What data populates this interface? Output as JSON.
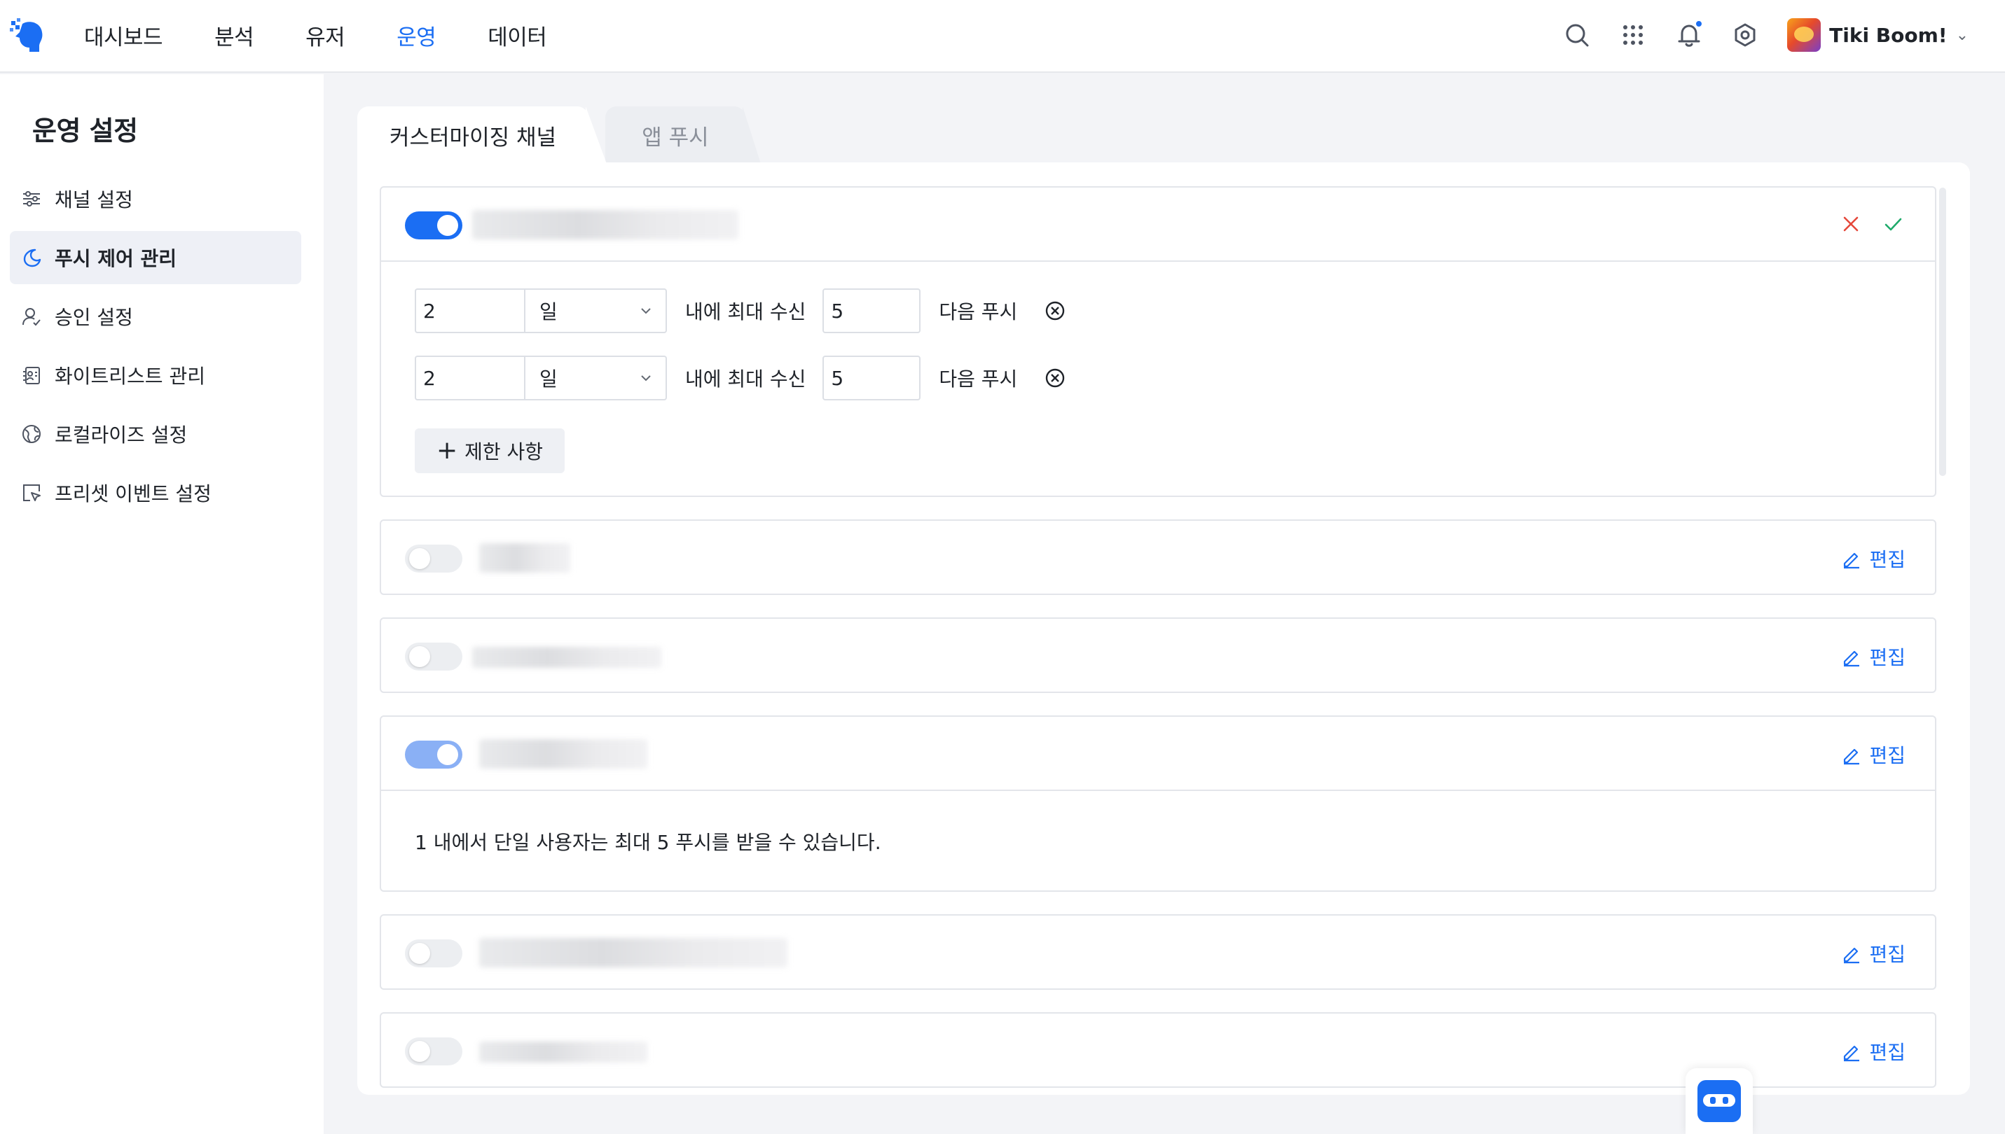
{
  "header": {
    "nav": [
      {
        "label": "대시보드",
        "active": false
      },
      {
        "label": "분석",
        "active": false
      },
      {
        "label": "유저",
        "active": false
      },
      {
        "label": "운영",
        "active": true
      },
      {
        "label": "데이터",
        "active": false
      }
    ],
    "icons": [
      "search-icon",
      "apps-grid-icon",
      "bell-icon",
      "settings-icon"
    ],
    "notification_dot": true,
    "user_name": "Tiki Boom!"
  },
  "sidebar": {
    "title": "운영 설정",
    "items": [
      {
        "label": "채널 설정",
        "icon": "sliders-icon",
        "active": false
      },
      {
        "label": "푸시 제어 관리",
        "icon": "moon-icon",
        "active": true
      },
      {
        "label": "승인 설정",
        "icon": "user-check-icon",
        "active": false
      },
      {
        "label": "화이트리스트 관리",
        "icon": "contact-list-icon",
        "active": false
      },
      {
        "label": "로컬라이즈 설정",
        "icon": "globe-icon",
        "active": false
      },
      {
        "label": "프리셋 이벤트 설정",
        "icon": "cursor-box-icon",
        "active": false
      }
    ]
  },
  "tabs": [
    {
      "label": "커스터마이징 채널",
      "active": true
    },
    {
      "label": "앱 푸시",
      "active": false
    }
  ],
  "channels": {
    "editing": {
      "enabled": true,
      "rules": [
        {
          "period_value": "2",
          "period_unit": "일",
          "label": "내에 최대 수신",
          "max_value": "5",
          "suffix": "다음 푸시"
        },
        {
          "period_value": "2",
          "period_unit": "일",
          "label": "내에 최대 수신",
          "max_value": "5",
          "suffix": "다음 푸시"
        }
      ],
      "add_rule_label": "제한 사항"
    },
    "edit_label": "편집",
    "list": [
      {
        "enabled": false
      },
      {
        "enabled": false
      },
      {
        "enabled": true,
        "description": "1 내에서 단일 사용자는 최대 5 푸시를 받을 수 있습니다."
      },
      {
        "enabled": false
      },
      {
        "enabled": false
      }
    ]
  },
  "colors": {
    "accent": "#1b6ef3",
    "cancel": "#e5483b",
    "confirm": "#1faa6b"
  }
}
